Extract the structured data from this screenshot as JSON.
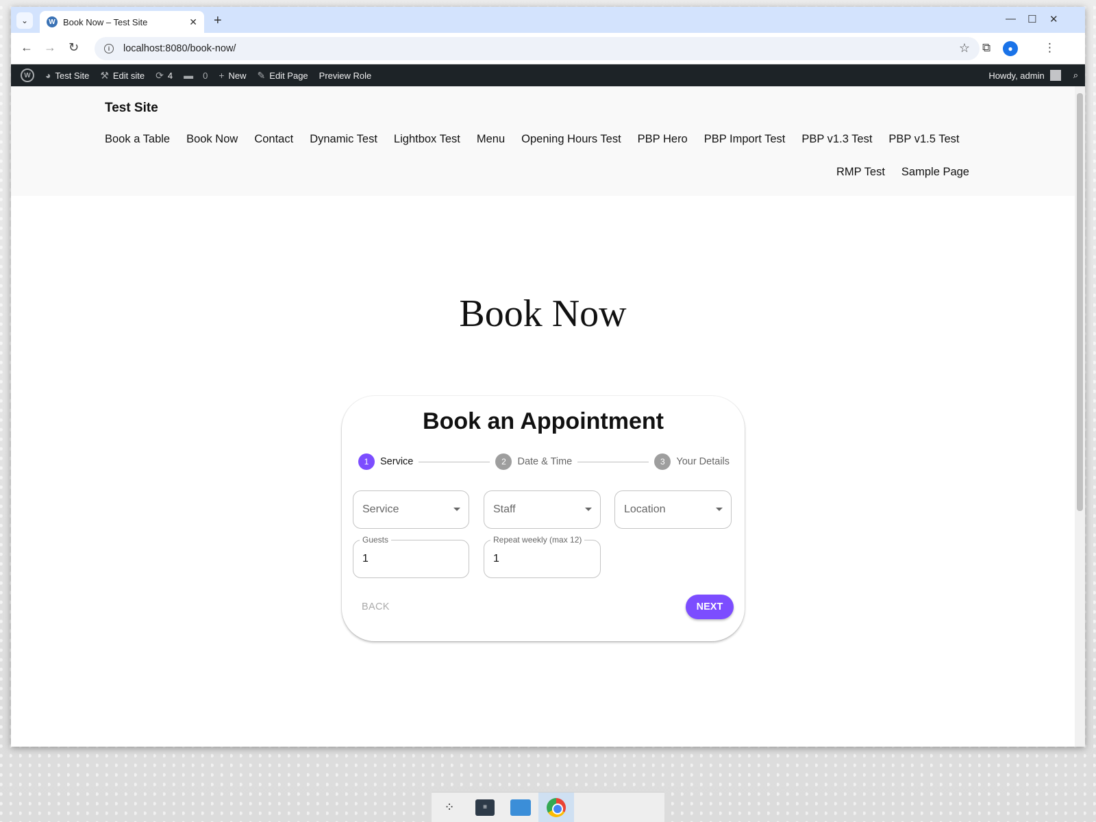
{
  "browser": {
    "tab_title": "Book Now – Test Site",
    "url": "localhost:8080/book-now/",
    "icons": [
      "tab-list-icon",
      "wordpress-favicon",
      "close-icon",
      "new-tab-icon",
      "minimize-icon",
      "maximize-icon",
      "window-close-icon",
      "back-icon",
      "forward-icon",
      "reload-icon",
      "site-info-icon",
      "bookmark-star-icon",
      "extensions-icon",
      "profile-icon",
      "more-menu-icon"
    ]
  },
  "adminbar": {
    "site_name": "Test Site",
    "edit_site": "Edit site",
    "updates_count": "4",
    "comments_count": "0",
    "new_label": "New",
    "edit_page": "Edit Page",
    "preview_role": "Preview Role",
    "howdy": "Howdy, admin"
  },
  "site": {
    "title": "Test Site",
    "nav_row1": [
      "Book a Table",
      "Book Now",
      "Contact",
      "Dynamic Test",
      "Lightbox Test",
      "Menu",
      "Opening Hours Test",
      "PBP Hero",
      "PBP Import Test",
      "PBP v1.3 Test",
      "PBP v1.5 Test"
    ],
    "nav_row2": [
      "RMP Test",
      "Sample Page"
    ],
    "page_title": "Book Now"
  },
  "booking": {
    "title": "Book an Appointment",
    "steps": [
      {
        "num": "1",
        "label": "Service",
        "active": true
      },
      {
        "num": "2",
        "label": "Date & Time",
        "active": false
      },
      {
        "num": "3",
        "label": "Your Details",
        "active": false
      }
    ],
    "service_placeholder": "Service",
    "staff_placeholder": "Staff",
    "location_placeholder": "Location",
    "guests_label": "Guests",
    "guests_value": "1",
    "repeat_label": "Repeat weekly (max 12)",
    "repeat_value": "1",
    "back_label": "BACK",
    "next_label": "NEXT",
    "accent_color": "#7c4dff"
  }
}
